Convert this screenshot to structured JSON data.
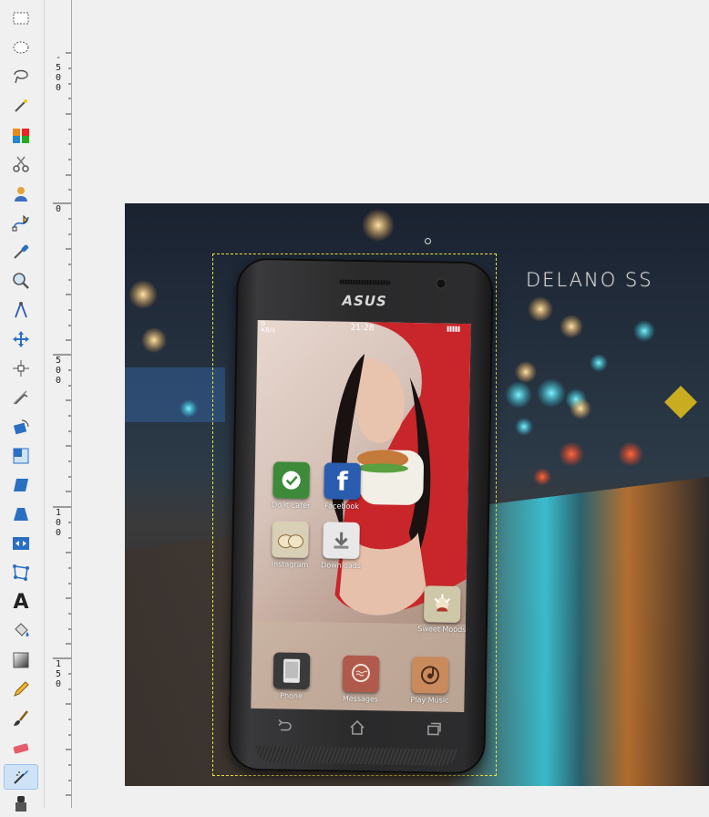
{
  "toolbox": {
    "tools": [
      {
        "name": "rect-select-tool",
        "icon": "rect-select-icon",
        "active": false
      },
      {
        "name": "ellipse-select-tool",
        "icon": "ellipse-select-icon",
        "active": false
      },
      {
        "name": "free-select-tool",
        "icon": "lasso-icon",
        "active": false
      },
      {
        "name": "fuzzy-select-tool",
        "icon": "magic-wand-icon",
        "active": false
      },
      {
        "name": "select-by-color-tool",
        "icon": "color-select-icon",
        "active": false
      },
      {
        "name": "scissors-select-tool",
        "icon": "scissors-icon",
        "active": false
      },
      {
        "name": "foreground-select-tool",
        "icon": "foreground-select-icon",
        "active": false
      },
      {
        "name": "paths-tool",
        "icon": "paths-icon",
        "active": false
      },
      {
        "name": "color-picker-tool",
        "icon": "eyedropper-icon",
        "active": false
      },
      {
        "name": "zoom-tool",
        "icon": "magnifier-icon",
        "active": false
      },
      {
        "name": "measure-tool",
        "icon": "compass-icon",
        "active": false
      },
      {
        "name": "move-tool",
        "icon": "move-icon",
        "active": false
      },
      {
        "name": "alignment-tool",
        "icon": "align-icon",
        "active": false
      },
      {
        "name": "crop-tool",
        "icon": "crop-icon",
        "active": false
      },
      {
        "name": "rotate-tool",
        "icon": "rotate-icon",
        "active": false
      },
      {
        "name": "scale-tool",
        "icon": "scale-icon",
        "active": false
      },
      {
        "name": "shear-tool",
        "icon": "shear-icon",
        "active": false
      },
      {
        "name": "perspective-tool",
        "icon": "perspective-icon",
        "active": false
      },
      {
        "name": "flip-tool",
        "icon": "flip-icon",
        "active": false
      },
      {
        "name": "cage-transform-tool",
        "icon": "cage-icon",
        "active": false
      },
      {
        "name": "text-tool",
        "icon": "text-icon",
        "active": false
      },
      {
        "name": "bucket-fill-tool",
        "icon": "bucket-icon",
        "active": false
      },
      {
        "name": "blend-tool",
        "icon": "gradient-icon",
        "active": false
      },
      {
        "name": "pencil-tool",
        "icon": "pencil-icon",
        "active": false
      },
      {
        "name": "paintbrush-tool",
        "icon": "paintbrush-icon",
        "active": false
      },
      {
        "name": "eraser-tool",
        "icon": "eraser-icon",
        "active": false
      },
      {
        "name": "airbrush-tool",
        "icon": "airbrush-icon",
        "active": true
      },
      {
        "name": "ink-tool",
        "icon": "ink-icon",
        "active": false
      }
    ],
    "text_tool_glyph": "A"
  },
  "vertical_ruler": {
    "labels": [
      {
        "text": "-\n5\n0\n0"
      },
      {
        "text": "0"
      },
      {
        "text": "5\n0\n0"
      },
      {
        "text": "1\n0\n0"
      },
      {
        "text": "1\n5\n0"
      }
    ]
  },
  "canvas": {
    "brand_text": "DELANO SS",
    "selection_color": "#e8e23a"
  },
  "phone": {
    "logo": "ASUS",
    "status_time": "21:28",
    "status_left": "0\nKB/s",
    "apps": [
      {
        "label": "Do It Later",
        "icon": "do-it-later-icon",
        "color": "#3d8a3a"
      },
      {
        "label": "Facebook",
        "icon": "facebook-icon",
        "color": "#2a5db0"
      },
      {
        "label": "Instagram",
        "icon": "instagram-icon",
        "color": "#d8cfb6"
      },
      {
        "label": "Downloads",
        "icon": "downloads-icon",
        "color": "#e8e8e8"
      },
      {
        "label": "Sweet Moods",
        "icon": "sweet-moods-icon",
        "color": "#cfc8a8"
      },
      {
        "label": "Phone",
        "icon": "phone-icon",
        "color": "#3a3a3a"
      },
      {
        "label": "Messages",
        "icon": "messages-icon",
        "color": "#b05a4c"
      },
      {
        "label": "Play Music",
        "icon": "play-music-icon",
        "color": "#c98a5c"
      }
    ],
    "nav": [
      "back-icon",
      "home-icon",
      "recents-icon"
    ]
  }
}
